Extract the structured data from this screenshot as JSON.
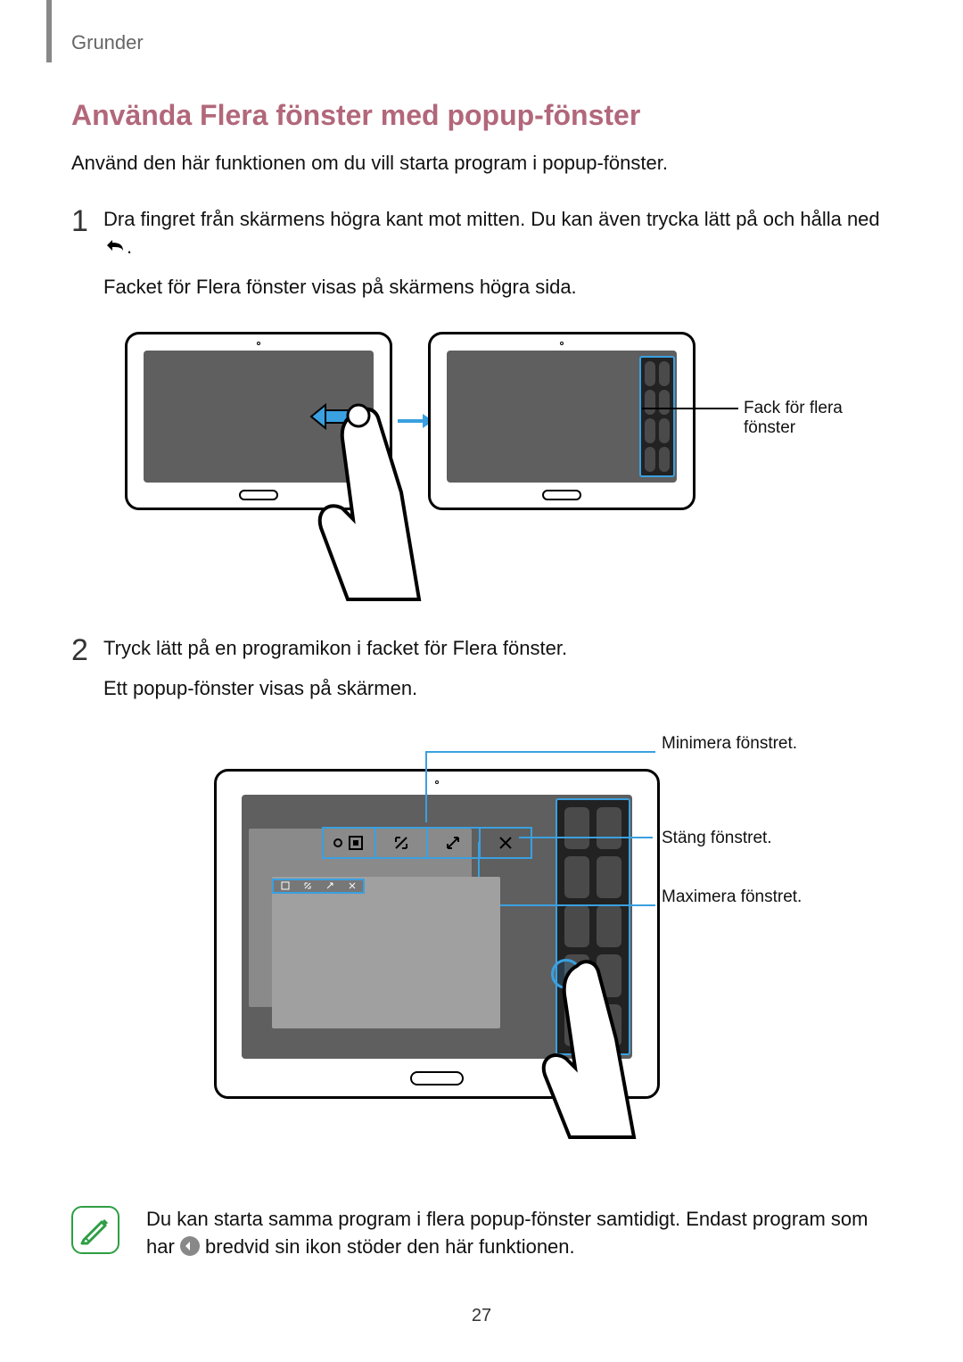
{
  "header": "Grunder",
  "section_title": "Använda Flera fönster med popup-fönster",
  "intro": "Använd den här funktionen om du vill starta program i popup-fönster.",
  "step1": {
    "num": "1",
    "line1": "Dra fingret från skärmens högra kant mot mitten. Du kan även trycka lätt på och hålla ned ",
    "line1_suffix": ".",
    "line2": "Facket för Flera fönster visas på skärmens högra sida.",
    "callout": "Fack för flera fönster"
  },
  "step2": {
    "num": "2",
    "line1": "Tryck lätt på en programikon i facket för Flera fönster.",
    "line2": "Ett popup-fönster visas på skärmen.",
    "callouts": {
      "minimize": "Minimera fönstret.",
      "close": "Stäng fönstret.",
      "maximize": "Maximera fönstret."
    }
  },
  "note": {
    "text_a": "Du kan starta samma program i flera popup-fönster samtidigt. Endast program som har ",
    "text_b": " bredvid sin ikon stöder den här funktionen."
  },
  "page_number": "27",
  "icons": {
    "back": "back-icon",
    "note": "note-icon",
    "badge": "◐"
  },
  "colors": {
    "accent_blue": "#3aa0e0",
    "heading": "#b2677a"
  }
}
